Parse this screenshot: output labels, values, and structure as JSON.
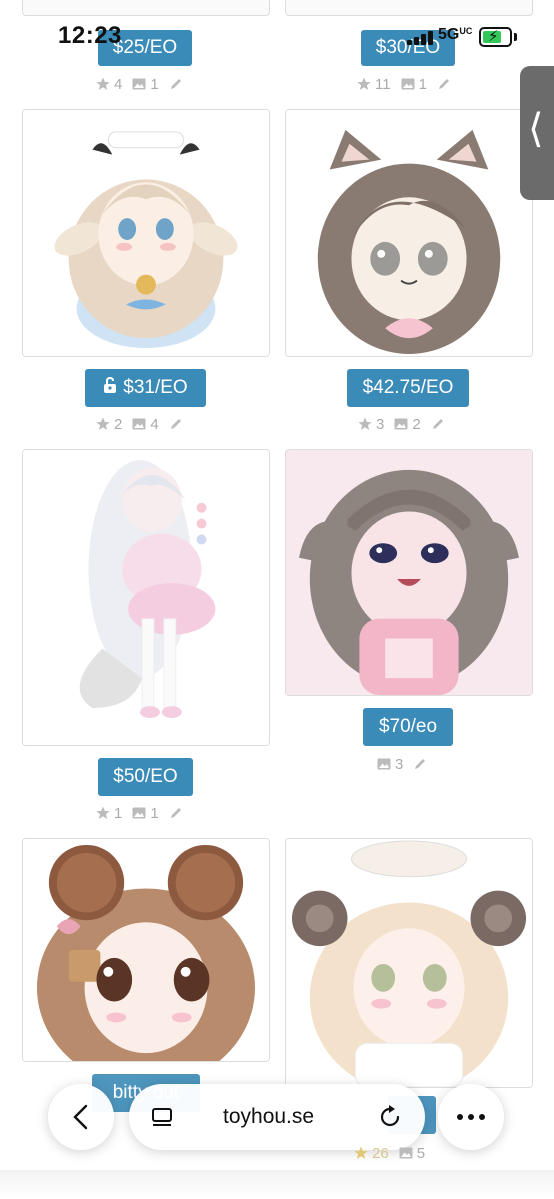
{
  "status_bar": {
    "time": "12:23",
    "network": "5G",
    "network_suffix": "UC"
  },
  "top_row": {
    "left": {
      "price": "$25/EO",
      "stars": "4",
      "images": "1"
    },
    "right": {
      "price": "$30/EO",
      "stars": "11",
      "images": "1"
    }
  },
  "cards": [
    {
      "price": "$31/EO",
      "locked": true,
      "stars": "2",
      "images": "4"
    },
    {
      "price": "$42.75/EO",
      "locked": false,
      "stars": "3",
      "images": "2"
    },
    {
      "price": "$50/EO",
      "locked": false,
      "stars": "1",
      "images": "1"
    },
    {
      "price": "$70/eo",
      "locked": false,
      "stars": "",
      "images": "3"
    },
    {
      "price": "bitty out",
      "locked": false,
      "stars": "",
      "images": ""
    },
    {
      "price": "",
      "locked": false,
      "stars": "26",
      "images": "5"
    }
  ],
  "browser": {
    "url": "toyhou.se"
  },
  "colors": {
    "price_button": "#3b8bb8",
    "meta_text": "#aaaaaa",
    "side_tab": "#6b6b6b"
  }
}
